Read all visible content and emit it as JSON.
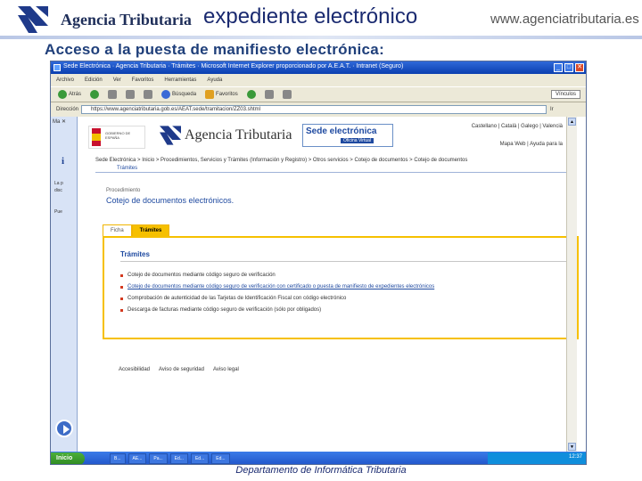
{
  "slide": {
    "logo_text": "Agencia Tributaria",
    "title": "expediente electrónico",
    "site_url": "www.agenciatributaria.es",
    "subtitle": "Acceso a la puesta de manifiesto electrónica:",
    "footer": "Departamento de Informática Tributaria"
  },
  "browser": {
    "window_title": "Sede Electrónica · Agencia Tributaria · Trámites · Microsoft Internet Explorer proporcionado por A.E.A.T. · Intranet (Seguro)",
    "menu": [
      "Archivo",
      "Edición",
      "Ver",
      "Favoritos",
      "Herramientas",
      "Ayuda"
    ],
    "toolbar": {
      "back": "Atrás",
      "search": "Búsqueda",
      "favorites": "Favoritos",
      "links": "Vínculos"
    },
    "address_label": "Dirección",
    "address_value": "https://www.agenciatributaria.gob.es/AEAT.sede/tramitacion/ZZ03.shtml",
    "go_label": "Ir",
    "sidepanel": {
      "close": "Ma ✕",
      "text1": "La p",
      "text2": "disc",
      "text3": "Pue"
    },
    "page": {
      "gov_label": "GOBIERNO DE ESPAÑA",
      "at_logo": "Agencia Tributaria",
      "sede_main": "Sede electrónica",
      "sede_sub": "Oficina Virtual",
      "languages": "Castellano | Català | Galego | Valencià",
      "right_links": "Mapa Web | Ayuda para la",
      "breadcrumb": "Sede Electrónica > Inicio > Procedimientos, Servicios y Trámites (Información y Registro) > Otros servicios > Cotejo de documentos > Cotejo de documentos",
      "breadcrumb_current": "Trámites",
      "proc_label": "Procedimiento",
      "proc_title": "Cotejo de documentos electrónicos.",
      "tabs": [
        "Ficha",
        "Trámites"
      ],
      "panel_title": "Trámites",
      "items": [
        "Cotejo de documentos mediante código seguro de verificación",
        "Cotejo de documentos mediante código seguro de verificación con certificado o puesta de manifiesto de expedientes electrónicos",
        "Comprobación de autenticidad de las Tarjetas de Identificación Fiscal con código electrónico",
        "Descarga de facturas mediante código seguro de verificación (sólo por obligados)"
      ],
      "footer_links": [
        "Accesibilidad",
        "Aviso de seguridad",
        "Aviso legal"
      ]
    },
    "taskbar": {
      "start": "Inicio",
      "items": [
        "B...",
        "AE...",
        "Pa...",
        "Ed...",
        "Ed...",
        "Ed..."
      ],
      "clock": "12:37"
    }
  },
  "colors": {
    "title_blue": "#1a2a70",
    "link_blue": "#1f4aa0",
    "accent_yellow": "#f6c000",
    "xp_blue": "#1f53c8"
  }
}
